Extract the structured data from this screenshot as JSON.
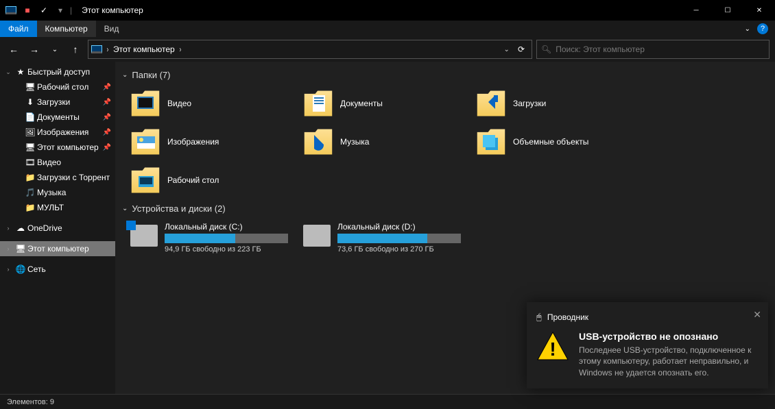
{
  "window": {
    "title": "Этот компьютер"
  },
  "ribbon": {
    "file": "Файл",
    "computer": "Компьютер",
    "view": "Вид"
  },
  "address": {
    "location": "Этот компьютер"
  },
  "search": {
    "placeholder": "Поиск: Этот компьютер"
  },
  "nav": {
    "quick": "Быстрый доступ",
    "quick_items": [
      {
        "label": "Рабочий стол",
        "pin": true,
        "ico": "🖥"
      },
      {
        "label": "Загрузки",
        "pin": true,
        "ico": "⬇"
      },
      {
        "label": "Документы",
        "pin": true,
        "ico": "📄"
      },
      {
        "label": "Изображения",
        "pin": true,
        "ico": "🖼"
      },
      {
        "label": "Этот компьютер",
        "pin": true,
        "ico": "🖥"
      },
      {
        "label": "Видео",
        "pin": false,
        "ico": "🎞"
      },
      {
        "label": "Загрузки с Торрент",
        "pin": false,
        "ico": "📁"
      },
      {
        "label": "Музыка",
        "pin": false,
        "ico": "🎵"
      },
      {
        "label": "МУЛЬТ",
        "pin": false,
        "ico": "📁"
      }
    ],
    "onedrive": "OneDrive",
    "thispc": "Этот компьютер",
    "network": "Сеть"
  },
  "groups": {
    "folders_hdr": "Папки (7)",
    "drives_hdr": "Устройства и диски (2)"
  },
  "folders": [
    {
      "label": "Видео"
    },
    {
      "label": "Документы"
    },
    {
      "label": "Загрузки"
    },
    {
      "label": "Изображения"
    },
    {
      "label": "Музыка"
    },
    {
      "label": "Объемные объекты"
    },
    {
      "label": "Рабочий стол"
    }
  ],
  "drives": [
    {
      "name": "Локальный диск (C:)",
      "free": "94,9 ГБ свободно из 223 ГБ",
      "fill": 57,
      "win": true
    },
    {
      "name": "Локальный диск (D:)",
      "free": "73,6 ГБ свободно из 270 ГБ",
      "fill": 73,
      "win": false
    }
  ],
  "status": {
    "items": "Элементов: 9"
  },
  "toast": {
    "app": "Проводник",
    "title": "USB-устройство не опознано",
    "body": "Последнее USB-устройство, подключенное к этому компьютеру, работает неправильно, и Windows не удается опознать его."
  }
}
